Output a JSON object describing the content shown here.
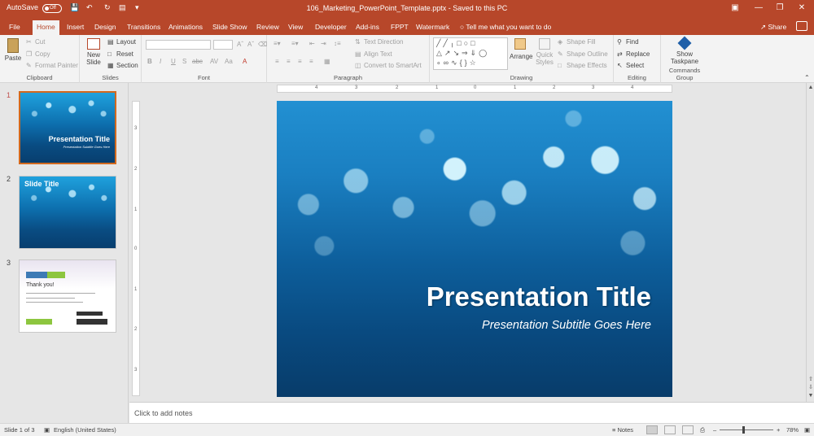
{
  "titlebar": {
    "autosave": "AutoSave",
    "autosave_state": "Off",
    "doc_title": "106_Marketing_PowerPoint_Template.pptx  -  Saved to this PC"
  },
  "tabs": [
    "File",
    "Home",
    "Insert",
    "Design",
    "Transitions",
    "Animations",
    "Slide Show",
    "Review",
    "View",
    "Developer",
    "Add-ins",
    "FPPT",
    "Watermark"
  ],
  "tell_me": "Tell me what you want to do",
  "share": "Share",
  "ribbon": {
    "clipboard": {
      "label": "Clipboard",
      "paste": "Paste",
      "cut": "Cut",
      "copy": "Copy",
      "format_painter": "Format Painter"
    },
    "slides": {
      "label": "Slides",
      "new_slide": "New Slide",
      "layout": "Layout",
      "reset": "Reset",
      "section": "Section"
    },
    "font": {
      "label": "Font",
      "bold": "B",
      "italic": "I",
      "underline": "U",
      "strike": "S",
      "abc": "abc",
      "av": "AV",
      "aa": "Aa"
    },
    "paragraph": {
      "label": "Paragraph",
      "text_direction": "Text Direction",
      "align_text": "Align Text",
      "convert_smartart": "Convert to SmartArt"
    },
    "drawing": {
      "label": "Drawing",
      "arrange": "Arrange",
      "quick_styles": "Quick Styles",
      "shape_fill": "Shape Fill",
      "shape_outline": "Shape Outline",
      "shape_effects": "Shape Effects"
    },
    "editing": {
      "label": "Editing",
      "find": "Find",
      "replace": "Replace",
      "select": "Select"
    },
    "commands": {
      "label": "Commands Group",
      "show": "Show",
      "taskpane": "Taskpane"
    }
  },
  "thumbnails": [
    {
      "num": "1",
      "title": "Presentation Title",
      "subtitle": "Presentation Subtitle Goes Here"
    },
    {
      "num": "2",
      "title": "Slide Title"
    },
    {
      "num": "3",
      "title": "Thank you!"
    }
  ],
  "ruler": {
    "h": [
      "4",
      "3",
      "2",
      "1",
      "0",
      "1",
      "2",
      "3",
      "4"
    ],
    "v": [
      "3",
      "2",
      "1",
      "0",
      "1",
      "2",
      "3"
    ]
  },
  "slide": {
    "title": "Presentation Title",
    "subtitle": "Presentation Subtitle Goes Here"
  },
  "notes_placeholder": "Click to add notes",
  "status": {
    "slide_info": "Slide 1 of 3",
    "language": "English (United States)",
    "notes": "Notes",
    "zoom": "78%"
  }
}
